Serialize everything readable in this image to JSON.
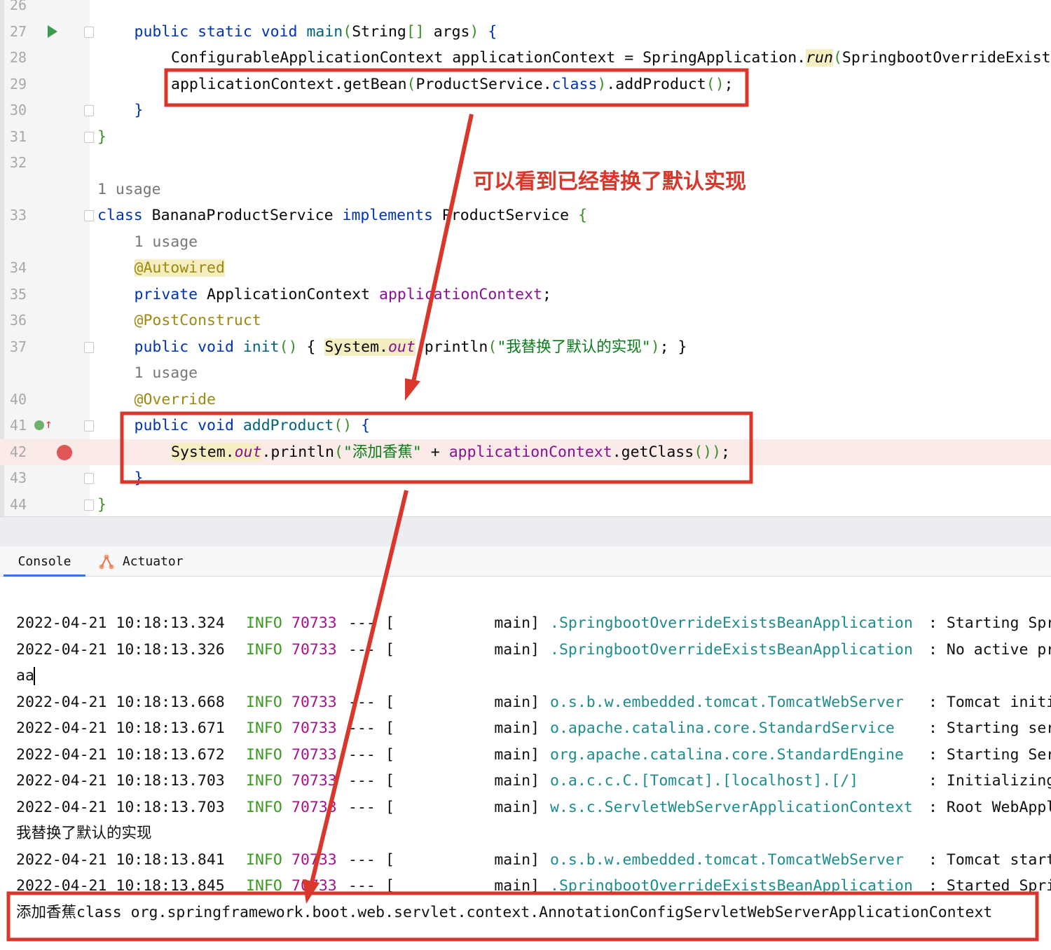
{
  "editor": {
    "rows": [
      {
        "ln": "26",
        "indent": 0,
        "tokens": []
      },
      {
        "ln": "27",
        "indent": 1,
        "run": true,
        "fold": true,
        "tokens": [
          {
            "t": "public static void ",
            "c": "kw"
          },
          {
            "t": "main",
            "c": "fn"
          },
          {
            "t": "(",
            "c": "par"
          },
          {
            "t": "String",
            "c": ""
          },
          {
            "t": "[]",
            "c": "par"
          },
          {
            "t": " args",
            "c": ""
          },
          {
            "t": ")",
            "c": "par"
          },
          {
            "t": " {",
            "c": "kw"
          }
        ]
      },
      {
        "ln": "28",
        "indent": 2,
        "tokens": [
          {
            "t": "ConfigurableApplicationContext applicationContext = SpringApplication.",
            "c": ""
          },
          {
            "t": "run",
            "c": "it hl"
          },
          {
            "t": "(",
            "c": "par"
          },
          {
            "t": "SpringbootOverrideExistsBeanApplication.",
            "c": ""
          }
        ]
      },
      {
        "ln": "29",
        "indent": 2,
        "tokens": [
          {
            "t": "applicationContext.getBean",
            "c": ""
          },
          {
            "t": "(",
            "c": "par"
          },
          {
            "t": "ProductService.",
            "c": ""
          },
          {
            "t": "class",
            "c": "kw"
          },
          {
            "t": ")",
            "c": "par"
          },
          {
            "t": ".addProduct",
            "c": ""
          },
          {
            "t": "()",
            "c": "par"
          },
          {
            "t": ";",
            "c": ""
          }
        ]
      },
      {
        "ln": "30",
        "indent": 1,
        "fold": true,
        "tokens": [
          {
            "t": "}",
            "c": "kw"
          }
        ]
      },
      {
        "ln": "31",
        "indent": 0,
        "fold": true,
        "tokens": [
          {
            "t": "}",
            "c": "par"
          }
        ]
      },
      {
        "ln": "32",
        "indent": 0,
        "tokens": []
      },
      {
        "ln": "",
        "indent": 0,
        "tokens": [
          {
            "t": "1 usage",
            "c": "gray"
          }
        ]
      },
      {
        "ln": "33",
        "indent": 0,
        "fold": true,
        "tokens": [
          {
            "t": "class",
            "c": "kw"
          },
          {
            "t": " BananaProductService ",
            "c": ""
          },
          {
            "t": "implements",
            "c": "kw"
          },
          {
            "t": " ProductService ",
            "c": ""
          },
          {
            "t": "{",
            "c": "par"
          }
        ]
      },
      {
        "ln": "",
        "indent": 1,
        "tokens": [
          {
            "t": "1 usage",
            "c": "gray"
          }
        ]
      },
      {
        "ln": "34",
        "indent": 1,
        "tokens": [
          {
            "t": "@Autowired",
            "c": "ann hl"
          }
        ]
      },
      {
        "ln": "35",
        "indent": 1,
        "tokens": [
          {
            "t": "private",
            "c": "kw"
          },
          {
            "t": " ApplicationContext ",
            "c": ""
          },
          {
            "t": "applicationContext",
            "c": "fld"
          },
          {
            "t": ";",
            "c": ""
          }
        ]
      },
      {
        "ln": "36",
        "indent": 1,
        "tokens": [
          {
            "t": "@PostConstruct",
            "c": "ann"
          }
        ]
      },
      {
        "ln": "37",
        "indent": 1,
        "fold": true,
        "tokens": [
          {
            "t": "public void ",
            "c": "kw"
          },
          {
            "t": "init",
            "c": "fn"
          },
          {
            "t": "() ",
            "c": "par"
          },
          {
            "t": "{ ",
            "c": ""
          },
          {
            "t": "System.",
            "c": "hl"
          },
          {
            "t": "out",
            "c": "fld it hl"
          },
          {
            "t": ".println",
            "c": ""
          },
          {
            "t": "(",
            "c": "par"
          },
          {
            "t": "\"我替换了默认的实现\"",
            "c": "str"
          },
          {
            "t": ")",
            "c": "par"
          },
          {
            "t": "; }",
            "c": ""
          }
        ]
      },
      {
        "ln": "",
        "indent": 1,
        "tokens": [
          {
            "t": "1 usage",
            "c": "gray"
          }
        ]
      },
      {
        "ln": "40",
        "indent": 1,
        "tokens": [
          {
            "t": "@Override",
            "c": "ann"
          }
        ]
      },
      {
        "ln": "41",
        "indent": 1,
        "impl": true,
        "fold": true,
        "tokens": [
          {
            "t": "public void ",
            "c": "kw"
          },
          {
            "t": "addProduct",
            "c": "fn"
          },
          {
            "t": "()",
            "c": "par"
          },
          {
            "t": " {",
            "c": "kw"
          }
        ]
      },
      {
        "ln": "42",
        "indent": 2,
        "bp": true,
        "tokens": [
          {
            "t": "System.",
            "c": "hl"
          },
          {
            "t": "out",
            "c": "fld it hl"
          },
          {
            "t": ".println",
            "c": ""
          },
          {
            "t": "(",
            "c": "par"
          },
          {
            "t": "\"添加香蕉\"",
            "c": "str"
          },
          {
            "t": " + ",
            "c": ""
          },
          {
            "t": "applicationContext",
            "c": "fld"
          },
          {
            "t": ".getClass",
            "c": ""
          },
          {
            "t": "()",
            "c": "par"
          },
          {
            "t": ")",
            "c": "par"
          },
          {
            "t": ";",
            "c": ""
          }
        ]
      },
      {
        "ln": "43",
        "indent": 1,
        "fold": true,
        "tokens": [
          {
            "t": "}",
            "c": "kw"
          }
        ]
      },
      {
        "ln": "44",
        "indent": 0,
        "fold": true,
        "tokens": [
          {
            "t": "}",
            "c": "par"
          }
        ]
      }
    ]
  },
  "annotation": "可以看到已经替换了默认实现",
  "tabs": [
    {
      "label": "Console",
      "active": true
    },
    {
      "label": "Actuator",
      "active": false
    }
  ],
  "console": {
    "lines": [
      {
        "ts": "2022-04-21 10:18:13.324",
        "lvl": "INFO",
        "pid": "70733",
        "sep": "---",
        "th": "[           main]",
        "log": ".SpringbootOverrideExistsBeanApplication",
        "msg": ": Starting Spr"
      },
      {
        "ts": "2022-04-21 10:18:13.326",
        "lvl": "INFO",
        "pid": "70733",
        "sep": "---",
        "th": "[           main]",
        "log": ".SpringbootOverrideExistsBeanApplication",
        "msg": ": No active pr"
      },
      {
        "plain": "aa"
      },
      {
        "ts": "2022-04-21 10:18:13.668",
        "lvl": "INFO",
        "pid": "70733",
        "sep": "---",
        "th": "[           main]",
        "log": "o.s.b.w.embedded.tomcat.TomcatWebServer",
        "msg": ": Tomcat initi"
      },
      {
        "ts": "2022-04-21 10:18:13.671",
        "lvl": "INFO",
        "pid": "70733",
        "sep": "---",
        "th": "[           main]",
        "log": "o.apache.catalina.core.StandardService",
        "msg": ": Starting ser"
      },
      {
        "ts": "2022-04-21 10:18:13.672",
        "lvl": "INFO",
        "pid": "70733",
        "sep": "---",
        "th": "[           main]",
        "log": "org.apache.catalina.core.StandardEngine",
        "msg": ": Starting Ser"
      },
      {
        "ts": "2022-04-21 10:18:13.703",
        "lvl": "INFO",
        "pid": "70733",
        "sep": "---",
        "th": "[           main]",
        "log": "o.a.c.c.C.[Tomcat].[localhost].[/]",
        "msg": ": Initializing"
      },
      {
        "ts": "2022-04-21 10:18:13.703",
        "lvl": "INFO",
        "pid": "70733",
        "sep": "---",
        "th": "[           main]",
        "log": "w.s.c.ServletWebServerApplicationContext",
        "msg": ": Root WebAppl"
      },
      {
        "plain": "我替换了默认的实现"
      },
      {
        "ts": "2022-04-21 10:18:13.841",
        "lvl": "INFO",
        "pid": "70733",
        "sep": "---",
        "th": "[           main]",
        "log": "o.s.b.w.embedded.tomcat.TomcatWebServer",
        "msg": ": Tomcat start"
      },
      {
        "ts": "2022-04-21 10:18:13.845",
        "lvl": "INFO",
        "pid": "70733",
        "sep": "---",
        "th": "[           main]",
        "log": ".SpringbootOverrideExistsBeanApplication",
        "msg": ": Started Spri"
      },
      {
        "plain": "添加香蕉class org.springframework.boot.web.servlet.context.AnnotationConfigServletWebServerApplicationContext"
      }
    ]
  },
  "colors": {
    "annotation": "#d9372b",
    "keyword": "#0033b3",
    "string": "#067d17"
  }
}
